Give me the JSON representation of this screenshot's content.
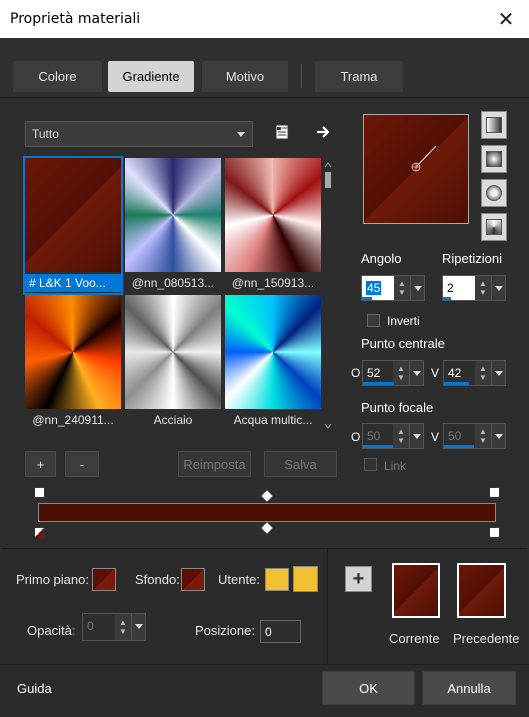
{
  "window": {
    "title": "Proprietà materiali",
    "close_glyph": "✕"
  },
  "tabs": [
    {
      "label": "Colore",
      "active": false
    },
    {
      "label": "Gradiente",
      "active": true
    },
    {
      "label": "Motivo",
      "active": false
    },
    {
      "label": "Trama",
      "active": false
    }
  ],
  "library": {
    "filter_value": "Tutto",
    "items": [
      {
        "label": "# L&K 1 Voo...",
        "selected": true
      },
      {
        "label": "@nn_080513...",
        "selected": false
      },
      {
        "label": "@nn_150913...",
        "selected": false
      },
      {
        "label": "@nn_240911...",
        "selected": false
      },
      {
        "label": "Acciaio",
        "selected": false
      },
      {
        "label": "Acqua multic...",
        "selected": false
      }
    ]
  },
  "buttons": {
    "add": "+",
    "remove": "-",
    "reset": "Reimposta",
    "save": "Salva",
    "swap_add": "+"
  },
  "angle": {
    "label": "Angolo",
    "value": "45"
  },
  "repeats": {
    "label": "Ripetizioni",
    "value": "2"
  },
  "invert": {
    "label": "Inverti",
    "checked": false
  },
  "center_point": {
    "label": "Punto centrale",
    "h_label": "O",
    "h_value": "52",
    "v_label": "V",
    "v_value": "42"
  },
  "focal_point": {
    "label": "Punto focale",
    "h_label": "O",
    "h_value": "50",
    "v_label": "V",
    "v_value": "50"
  },
  "link": {
    "label": "Link",
    "checked": false
  },
  "stops": {
    "foreground_label": "Primo piano:",
    "background_label": "Sfondo:",
    "user_label": "Utente:",
    "user_color": "#f0c030",
    "opacity_label": "Opacità:",
    "opacity_value": "0",
    "position_label": "Posizione:",
    "position_value": "0"
  },
  "compare": {
    "current_label": "Corrente",
    "previous_label": "Precedente"
  },
  "footer": {
    "help": "Guida",
    "ok": "OK",
    "cancel": "Annulla"
  },
  "colors": {
    "accent": "#0078d7",
    "gradient_dark": "#4b1004",
    "gradient_mid": "#6d1606"
  }
}
